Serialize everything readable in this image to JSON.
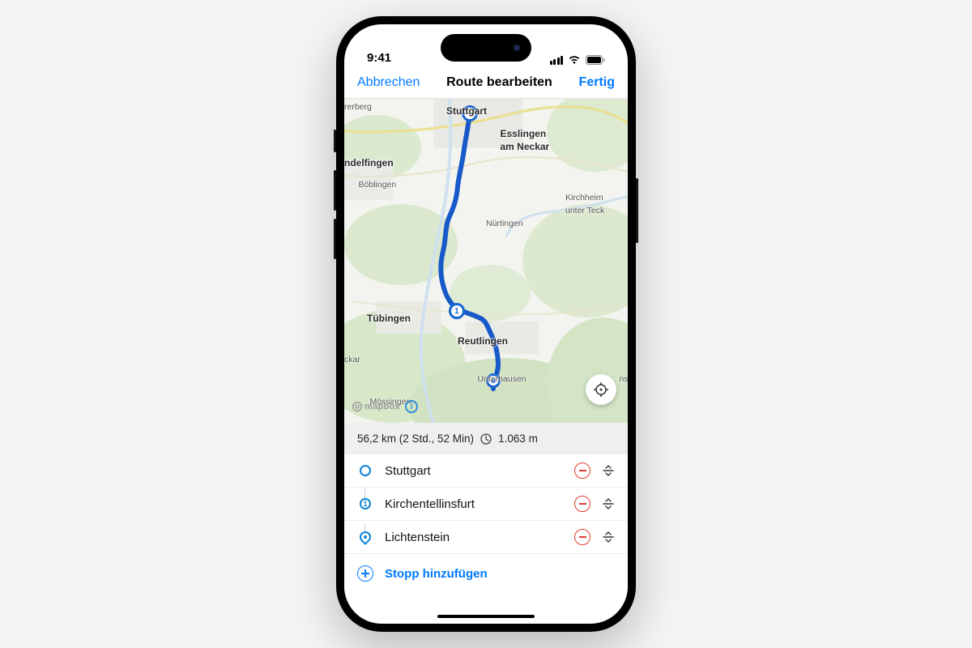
{
  "status": {
    "time": "9:41"
  },
  "nav": {
    "cancel": "Abbrechen",
    "title": "Route bearbeiten",
    "done": "Fertig"
  },
  "map": {
    "attribution": "mapbox",
    "cities": {
      "stuttgart": "Stuttgart",
      "esslingen_l1": "Esslingen",
      "esslingen_l2": "am Neckar",
      "sindelfingen": "ndelfingen",
      "boeblingen": "Böblingen",
      "kirchheim_l1": "Kirchheim",
      "kirchheim_l2": "unter Teck",
      "nuertingen": "Nürtingen",
      "tuebingen": "Tübingen",
      "reutlingen": "Reutlingen",
      "moessingen": "Mössingen",
      "unterhausen": "Unterhausen",
      "rerberg": "rerberg",
      "ckar": "ckar",
      "ns": "ns"
    },
    "waypoint1": "1"
  },
  "summary": {
    "text": "56,2 km (2 Std., 52 Min)",
    "elevation": "1.063 m"
  },
  "stops": [
    {
      "name": "Stuttgart",
      "marker": "start"
    },
    {
      "name": "Kirchentellinsfurt",
      "marker": "1"
    },
    {
      "name": "Lichtenstein",
      "marker": "dest"
    }
  ],
  "add_stop": "Stopp hinzufügen"
}
